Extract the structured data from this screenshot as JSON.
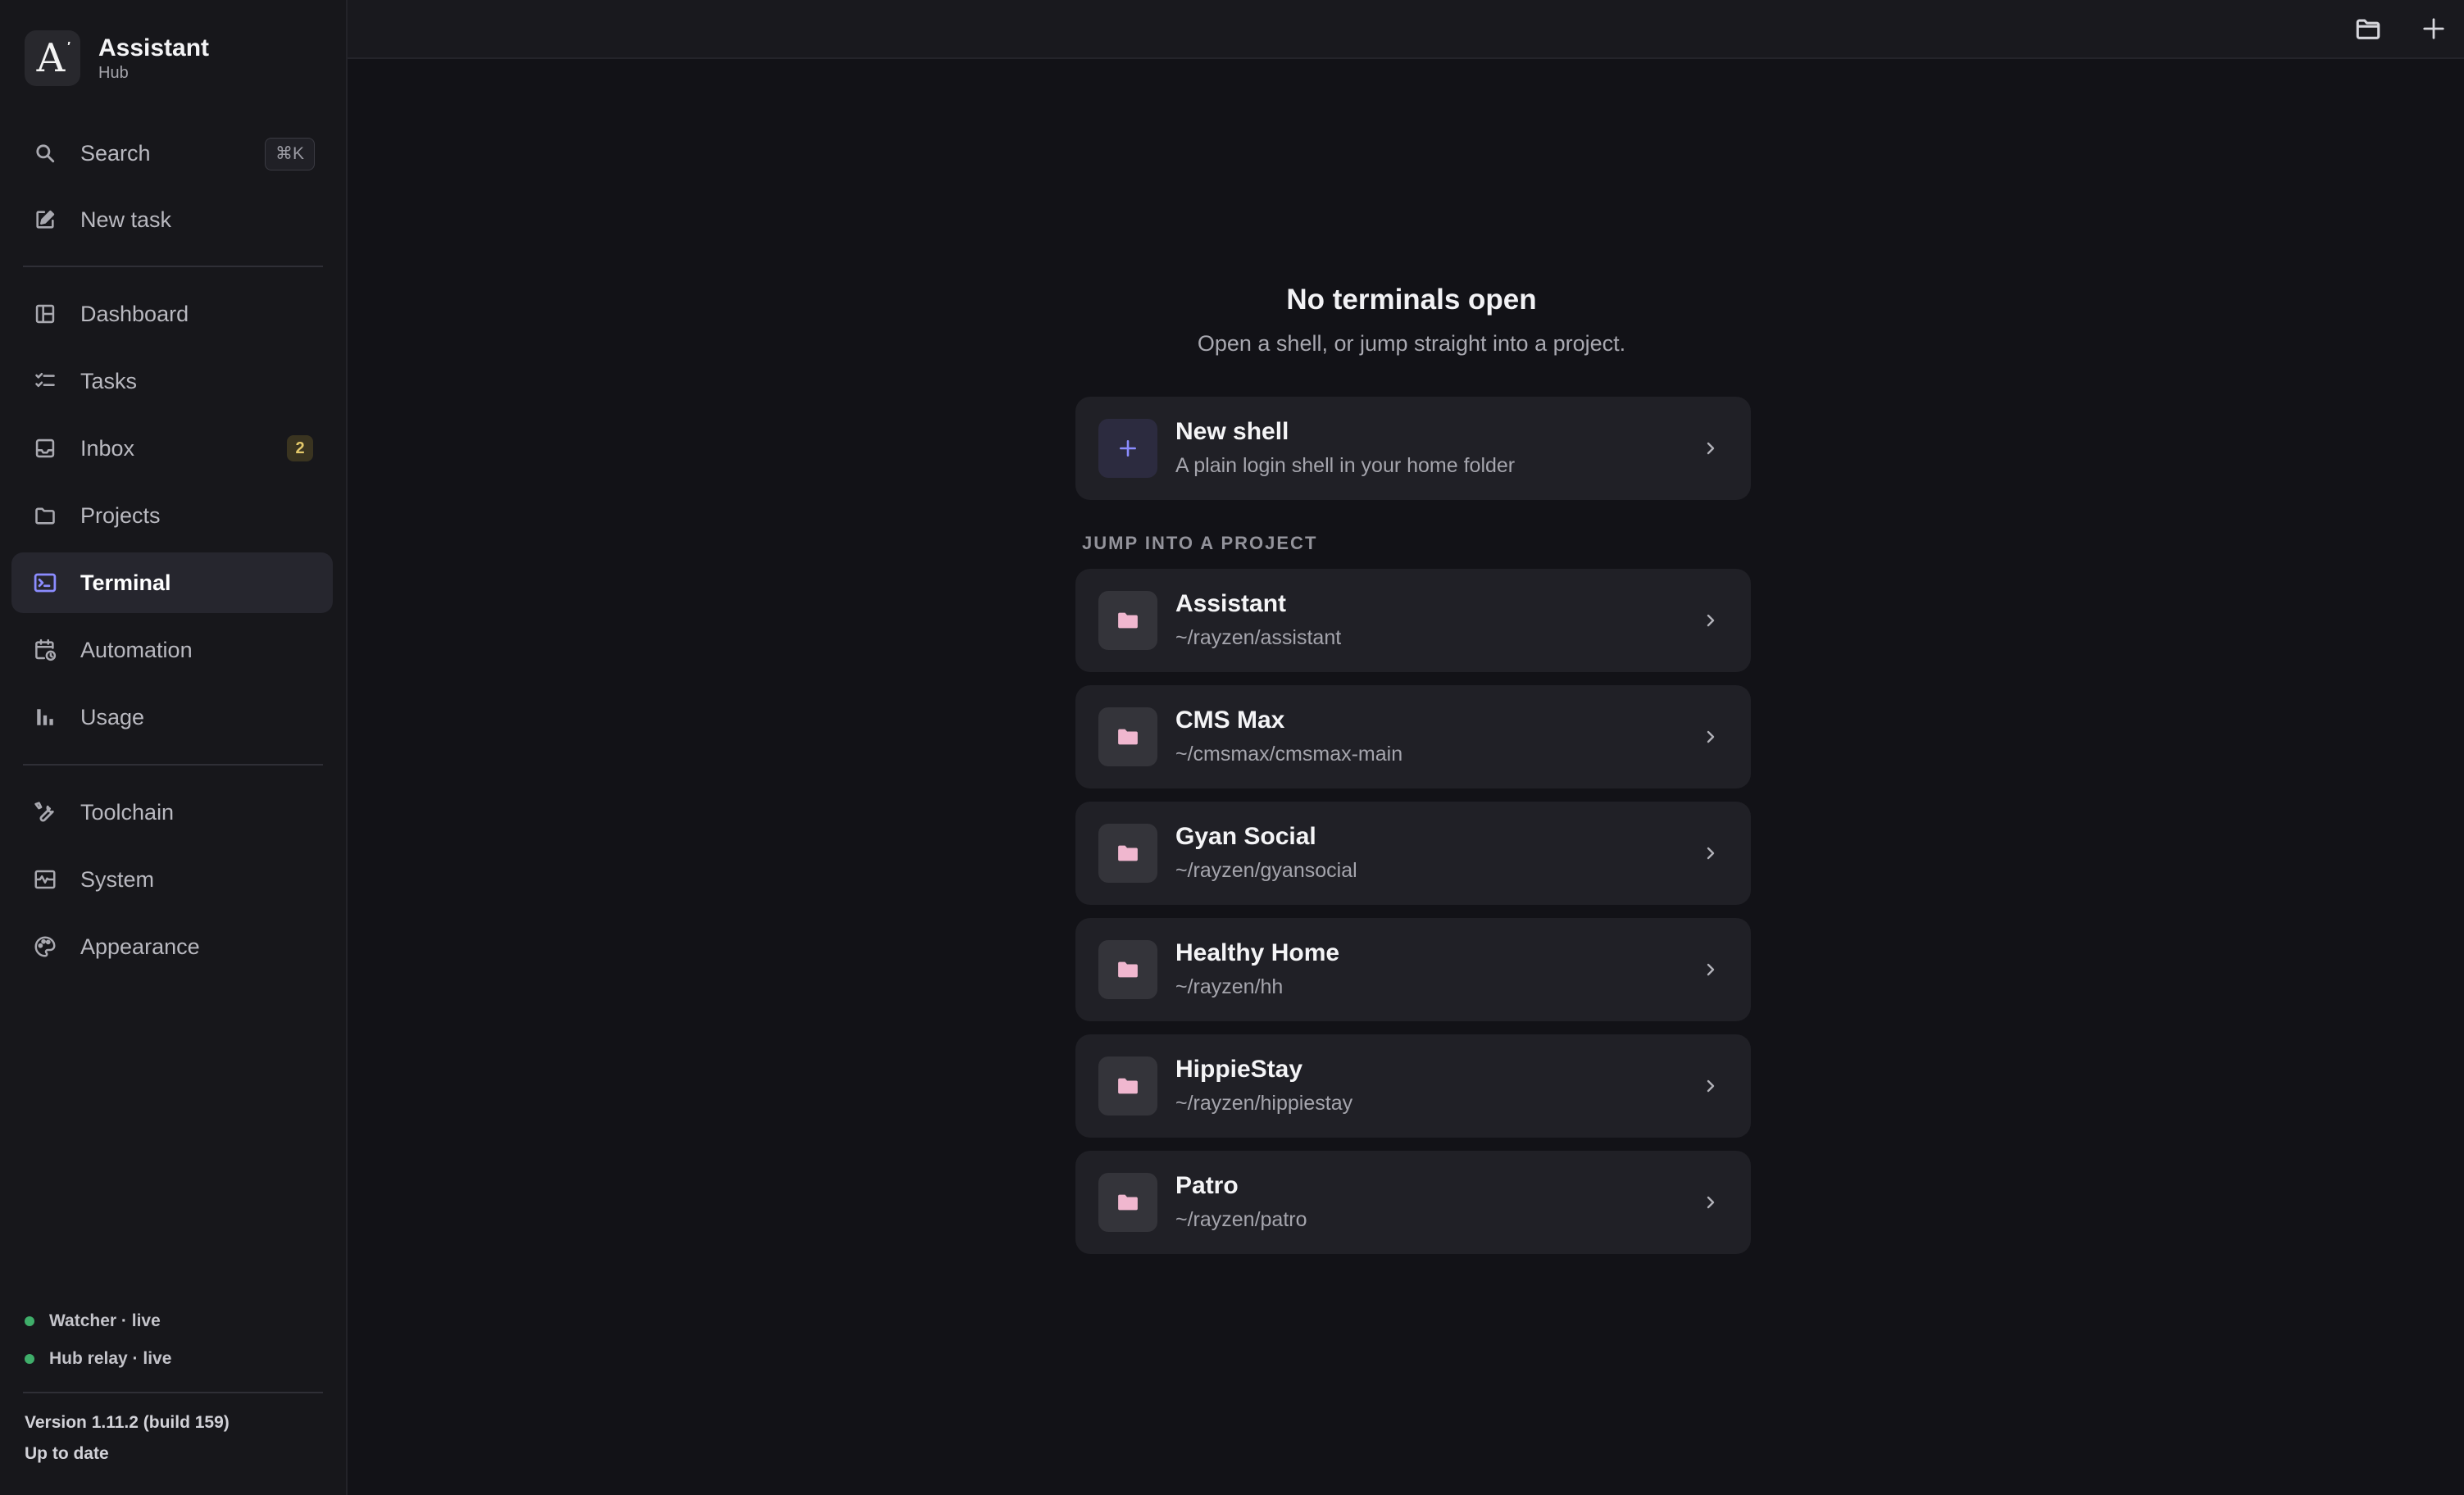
{
  "app": {
    "name": "Assistant",
    "subtitle": "Hub",
    "logo_letter": "A",
    "logo_mark": "′"
  },
  "sidebar": {
    "search": {
      "label": "Search",
      "shortcut": "⌘K"
    },
    "new_task": {
      "label": "New task"
    },
    "nav": [
      {
        "id": "dashboard",
        "label": "Dashboard",
        "icon": "dashboard-icon"
      },
      {
        "id": "tasks",
        "label": "Tasks",
        "icon": "tasks-icon"
      },
      {
        "id": "inbox",
        "label": "Inbox",
        "icon": "inbox-icon",
        "badge": "2"
      },
      {
        "id": "projects",
        "label": "Projects",
        "icon": "folder-icon"
      },
      {
        "id": "terminal",
        "label": "Terminal",
        "icon": "terminal-icon",
        "active": true
      },
      {
        "id": "automation",
        "label": "Automation",
        "icon": "calendar-clock-icon"
      },
      {
        "id": "usage",
        "label": "Usage",
        "icon": "bar-chart-icon"
      }
    ],
    "settings": [
      {
        "id": "toolchain",
        "label": "Toolchain",
        "icon": "wrench-icon"
      },
      {
        "id": "system",
        "label": "System",
        "icon": "monitor-heart-icon"
      },
      {
        "id": "appearance",
        "label": "Appearance",
        "icon": "palette-icon"
      }
    ],
    "status": [
      {
        "label": "Watcher · live",
        "color": "#3fae6a"
      },
      {
        "label": "Hub relay · live",
        "color": "#3fae6a"
      }
    ],
    "version": "Version 1.11.2 (build 159)",
    "update_status": "Up to date"
  },
  "topbar": {
    "icons": [
      "folder-icon",
      "plus-icon"
    ]
  },
  "main": {
    "empty_title": "No terminals open",
    "empty_subtitle": "Open a shell, or jump straight into a project.",
    "new_shell": {
      "title": "New shell",
      "subtitle": "A plain login shell in your home folder"
    },
    "section_label": "JUMP INTO A PROJECT",
    "projects": [
      {
        "name": "Assistant",
        "path": "~/rayzen/assistant"
      },
      {
        "name": "CMS Max",
        "path": "~/cmsmax/cmsmax-main"
      },
      {
        "name": "Gyan Social",
        "path": "~/rayzen/gyansocial"
      },
      {
        "name": "Healthy Home",
        "path": "~/rayzen/hh"
      },
      {
        "name": "HippieStay",
        "path": "~/rayzen/hippiestay"
      },
      {
        "name": "Patro",
        "path": "~/rayzen/patro"
      }
    ]
  },
  "colors": {
    "accent": "#8b8cff",
    "folder_icon": "#f0b7cf",
    "background": "#121217",
    "sidebar": "#17171b",
    "card": "#202026",
    "live": "#3fae6a"
  }
}
